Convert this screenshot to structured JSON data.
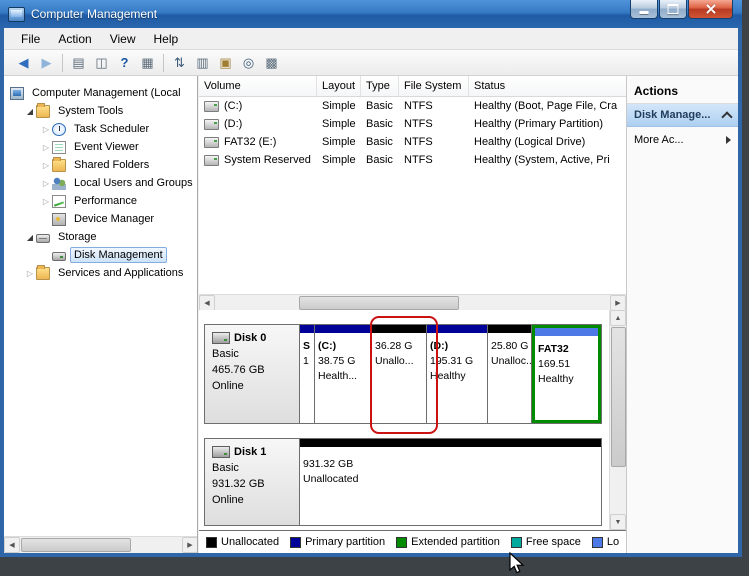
{
  "window": {
    "title": "Computer Management"
  },
  "menu": {
    "items": [
      "File",
      "Action",
      "View",
      "Help"
    ]
  },
  "toolbar": {
    "icons": [
      {
        "name": "back",
        "glyph": "◀",
        "color": "#2f6fbe"
      },
      {
        "name": "forward",
        "glyph": "▶",
        "color": "#8fb3d9"
      },
      {
        "name": "show-hide-tree",
        "glyph": "▤",
        "color": "#5a6b7a"
      },
      {
        "name": "two-panes",
        "glyph": "◫",
        "color": "#5a6b7a"
      },
      {
        "name": "help",
        "glyph": "?",
        "color": "#1a56a0"
      },
      {
        "name": "export-list",
        "glyph": "▦",
        "color": "#5a6b7a"
      },
      {
        "name": "refresh",
        "glyph": "⇅",
        "color": "#3d5a78"
      },
      {
        "name": "disk-view",
        "glyph": "▥",
        "color": "#5a6b7a"
      },
      {
        "name": "open-folder",
        "glyph": "▣",
        "color": "#a07c2e"
      },
      {
        "name": "search",
        "glyph": "◎",
        "color": "#3d5a78"
      },
      {
        "name": "settings",
        "glyph": "▩",
        "color": "#5a6b7a"
      }
    ]
  },
  "tree": {
    "items": [
      {
        "label": "Computer Management (Local"
      },
      {
        "label": "System Tools"
      },
      {
        "label": "Task Scheduler"
      },
      {
        "label": "Event Viewer"
      },
      {
        "label": "Shared Folders"
      },
      {
        "label": "Local Users and Groups"
      },
      {
        "label": "Performance"
      },
      {
        "label": "Device Manager"
      },
      {
        "label": "Storage"
      },
      {
        "label": "Disk Management"
      },
      {
        "label": "Services and Applications"
      }
    ]
  },
  "volumes": {
    "columns": [
      "Volume",
      "Layout",
      "Type",
      "File System",
      "Status"
    ],
    "rows": [
      {
        "volume": "(C:)",
        "layout": "Simple",
        "type": "Basic",
        "fs": "NTFS",
        "status": "Healthy (Boot, Page File, Cra"
      },
      {
        "volume": "(D:)",
        "layout": "Simple",
        "type": "Basic",
        "fs": "NTFS",
        "status": "Healthy (Primary Partition)"
      },
      {
        "volume": "FAT32 (E:)",
        "layout": "Simple",
        "type": "Basic",
        "fs": "NTFS",
        "status": "Healthy (Logical Drive)"
      },
      {
        "volume": "System Reserved",
        "layout": "Simple",
        "type": "Basic",
        "fs": "NTFS",
        "status": "Healthy (System, Active, Pri"
      }
    ]
  },
  "disks": [
    {
      "name": "Disk 0",
      "type": "Basic",
      "size": "465.76 GB",
      "status": "Online",
      "partitions": [
        {
          "name": "S",
          "size": "1",
          "status": ""
        },
        {
          "name": "(C:)",
          "size": "38.75 G",
          "status": "Health..."
        },
        {
          "name": "",
          "size": "36.28 G",
          "status": "Unallo..."
        },
        {
          "name": "(D:)",
          "size": "195.31 G",
          "status": "Healthy"
        },
        {
          "name": "",
          "size": "25.80 G",
          "status": "Unalloc..."
        },
        {
          "name": "FAT32",
          "size": "169.51",
          "status": "Healthy"
        }
      ]
    },
    {
      "name": "Disk 1",
      "type": "Basic",
      "size": "931.32 GB",
      "status": "Online",
      "partitions": [
        {
          "name": "",
          "size": "931.32 GB",
          "status": "Unallocated"
        }
      ]
    }
  ],
  "legend": {
    "items": [
      {
        "label": "Unallocated",
        "color": "#000000"
      },
      {
        "label": "Primary partition",
        "color": "#000099"
      },
      {
        "label": "Extended partition",
        "color": "#008a00"
      },
      {
        "label": "Free space",
        "color": "#00a99d"
      },
      {
        "label": "Lo",
        "color": "#4d79e6"
      }
    ]
  },
  "colors": {
    "strip_primary": "#000099",
    "strip_unallocated": "#000000",
    "strip_logical": "#4d79e6",
    "extended_border": "#008a00",
    "annotation_red": "#cc1111"
  },
  "actions": {
    "header": "Actions",
    "disk_management": "Disk Manage...",
    "more_actions": "More Ac..."
  }
}
